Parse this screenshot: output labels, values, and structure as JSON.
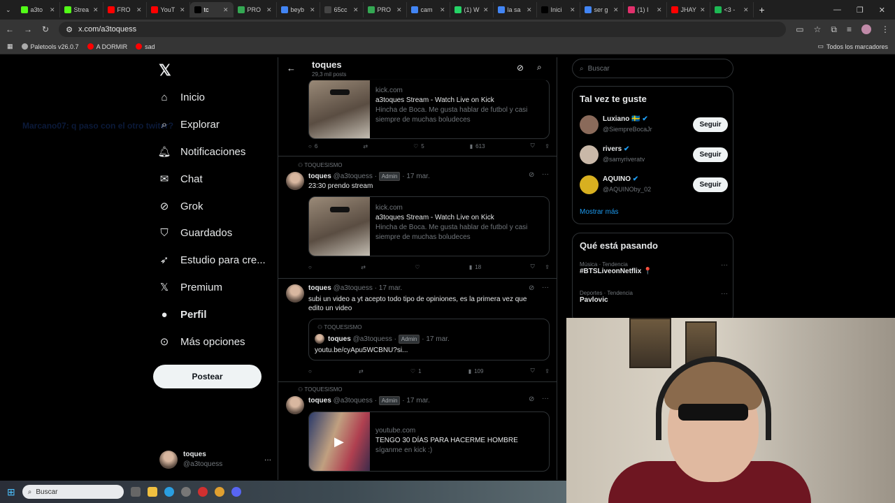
{
  "browser": {
    "tabs": [
      {
        "label": "a3to",
        "color": "#53fc18"
      },
      {
        "label": "Strea",
        "color": "#53fc18"
      },
      {
        "label": "FRO",
        "color": "#ff0000"
      },
      {
        "label": "YouT",
        "color": "#ff0000"
      },
      {
        "label": "tc",
        "color": "#000000"
      },
      {
        "label": "PRO",
        "color": "#34a853"
      },
      {
        "label": "beyb",
        "color": "#4285f4"
      },
      {
        "label": "65cc",
        "color": "#444444"
      },
      {
        "label": "PRO",
        "color": "#34a853"
      },
      {
        "label": "cam",
        "color": "#4285f4"
      },
      {
        "label": "(1) W",
        "color": "#25d366"
      },
      {
        "label": "la sa",
        "color": "#4285f4"
      },
      {
        "label": "Inici",
        "color": "#000000"
      },
      {
        "label": "ser g",
        "color": "#4285f4"
      },
      {
        "label": "(1) I",
        "color": "#e1306c"
      },
      {
        "label": "JHAY",
        "color": "#ff0000"
      },
      {
        "label": "<3 -",
        "color": "#1db954"
      }
    ],
    "url": "x.com/a3toquess",
    "bookmarks": [
      {
        "label": "Paletools v26.0.7",
        "color": "#aaaaaa"
      },
      {
        "label": "A DORMIR",
        "color": "#ff0000"
      },
      {
        "label": "sad",
        "color": "#ff0000"
      }
    ],
    "all_bookmarks": "Todos los marcadores"
  },
  "ghost_chat": {
    "user": "Marcano07",
    "text": ": q paso con el otro twiter?"
  },
  "nav": {
    "items": [
      {
        "label": "Inicio",
        "icon": "home-icon"
      },
      {
        "label": "Explorar",
        "icon": "search-icon"
      },
      {
        "label": "Notificaciones",
        "icon": "bell-icon"
      },
      {
        "label": "Chat",
        "icon": "mail-icon"
      },
      {
        "label": "Grok",
        "icon": "grok-icon"
      },
      {
        "label": "Guardados",
        "icon": "bookmark-icon"
      },
      {
        "label": "Estudio para cre...",
        "icon": "rocket-icon"
      },
      {
        "label": "Premium",
        "icon": "x-logo-icon"
      },
      {
        "label": "Perfil",
        "icon": "person-icon"
      },
      {
        "label": "Más opciones",
        "icon": "more-icon"
      }
    ],
    "post_label": "Postear",
    "account_name": "toques",
    "account_handle": "@a3toquess"
  },
  "profile_header": {
    "name": "toques",
    "posts": "29,3 mil posts"
  },
  "tweets": {
    "t0": {
      "card_domain": "kick.com",
      "card_title": "a3toques Stream - Watch Live on Kick",
      "card_desc": "Hincha de Boca. Me gusta hablar de futbol y casi siempre de muchas boludeces",
      "replies": "6",
      "likes": "5",
      "views": "613"
    },
    "t1": {
      "community": "TOQUESISMO",
      "name": "toques",
      "handle": "@a3toquess",
      "badge": "Admin",
      "date": "17 mar.",
      "text": "23:30 prendo stream",
      "card_domain": "kick.com",
      "card_title": "a3toques Stream - Watch Live on Kick",
      "card_desc": "Hincha de Boca. Me gusta hablar de futbol y casi siempre de muchas boludeces",
      "views": "18"
    },
    "t2": {
      "name": "toques",
      "handle": "@a3toquess",
      "date": "17 mar.",
      "text": "subi un video a yt acepto todo tipo de opiniones, es la primera vez que edito un video",
      "quote_community": "TOQUESISMO",
      "quote_name": "toques",
      "quote_handle": "@a3toquess",
      "quote_badge": "Admin",
      "quote_date": "17 mar.",
      "quote_text": "youtu.be/cyApu5WCBNU?si...",
      "likes": "1",
      "views": "109"
    },
    "t3": {
      "community": "TOQUESISMO",
      "name": "toques",
      "handle": "@a3toquess",
      "badge": "Admin",
      "date": "17 mar.",
      "card_domain": "youtube.com",
      "card_title": "TENGO 30 DÍAS PARA HACERME HOMBRE",
      "card_desc": "síganme en kick :)"
    }
  },
  "search_placeholder": "Buscar",
  "suggestions": {
    "title": "Tal vez te guste",
    "items": [
      {
        "name": "Luxiano 🇸🇪",
        "handle": "@SiempreBocaJr",
        "follow": "Seguir"
      },
      {
        "name": "rivers",
        "handle": "@samyriveratv",
        "follow": "Seguir"
      },
      {
        "name": "AQUINO",
        "handle": "@AQUINOby_02",
        "follow": "Seguir"
      }
    ],
    "more": "Mostrar más"
  },
  "trends": {
    "title": "Qué está pasando",
    "items": [
      {
        "category": "Música · Tendencia",
        "topic": "#BTSLiveonNetflix 📍"
      },
      {
        "category": "Deportes · Tendencia",
        "topic": "Pavlovic"
      }
    ]
  },
  "taskbar": {
    "search_placeholder": "Buscar"
  },
  "colors": {
    "accent": "#1d9bf0",
    "border": "#2f3336",
    "muted": "#71767b"
  }
}
